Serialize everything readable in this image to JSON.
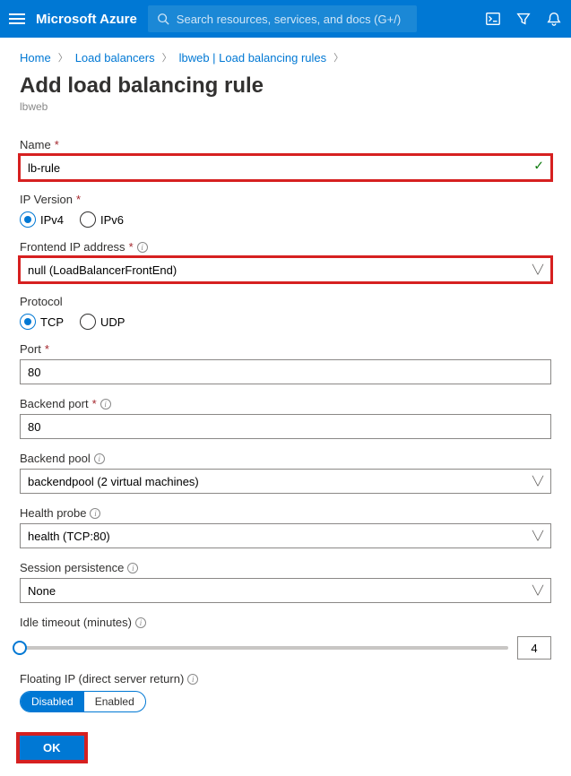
{
  "topbar": {
    "brand": "Microsoft Azure",
    "search_placeholder": "Search resources, services, and docs (G+/)"
  },
  "breadcrumb": {
    "items": [
      "Home",
      "Load balancers",
      "lbweb | Load balancing rules"
    ]
  },
  "header": {
    "title": "Add load balancing rule",
    "subtitle": "lbweb"
  },
  "form": {
    "name": {
      "label": "Name",
      "value": "lb-rule"
    },
    "ip_version": {
      "label": "IP Version",
      "options": [
        "IPv4",
        "IPv6"
      ],
      "selected": "IPv4"
    },
    "frontend_ip": {
      "label": "Frontend IP address",
      "value": "null (LoadBalancerFrontEnd)"
    },
    "protocol": {
      "label": "Protocol",
      "options": [
        "TCP",
        "UDP"
      ],
      "selected": "TCP"
    },
    "port": {
      "label": "Port",
      "value": "80"
    },
    "backend_port": {
      "label": "Backend port",
      "value": "80"
    },
    "backend_pool": {
      "label": "Backend pool",
      "value": "backendpool (2 virtual machines)"
    },
    "health_probe": {
      "label": "Health probe",
      "value": "health (TCP:80)"
    },
    "session_persistence": {
      "label": "Session persistence",
      "value": "None"
    },
    "idle_timeout": {
      "label": "Idle timeout (minutes)",
      "value": "4"
    },
    "floating_ip": {
      "label": "Floating IP (direct server return)",
      "options": [
        "Disabled",
        "Enabled"
      ],
      "selected": "Disabled"
    }
  },
  "footer": {
    "ok": "OK"
  }
}
